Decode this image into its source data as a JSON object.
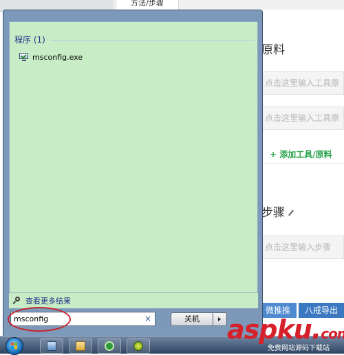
{
  "background_page": {
    "tab_label": "方法/步骤",
    "materials_heading": "原料",
    "materials_input_placeholder": "点击这里输入工具原",
    "add_tool_label": "+ 添加工具/原料",
    "steps_heading": "步骤",
    "steps_input_placeholder": "点击这里输入步骤",
    "button_recommend": "微推推",
    "button_other": "八戒导出"
  },
  "start_menu": {
    "group_title": "程序 (1)",
    "results": [
      {
        "label": "msconfig.exe",
        "icon": "msconfig-monitor-icon"
      }
    ],
    "more_results_label": "查看更多结果",
    "search_value": "msconfig",
    "search_clear_glyph": "×",
    "shutdown_label": "关机"
  },
  "watermark": {
    "brand": "aspku",
    "dot": ".",
    "tld": "com",
    "sub": "免费网站源码下载站"
  },
  "colors": {
    "results_bg": "#c8ecc6",
    "menu_frame": "#7d99b9",
    "highlight_oval": "#c8242c",
    "watermark": "#d6202a",
    "link_blue": "#1e3287",
    "add_green": "#2aa44c"
  }
}
